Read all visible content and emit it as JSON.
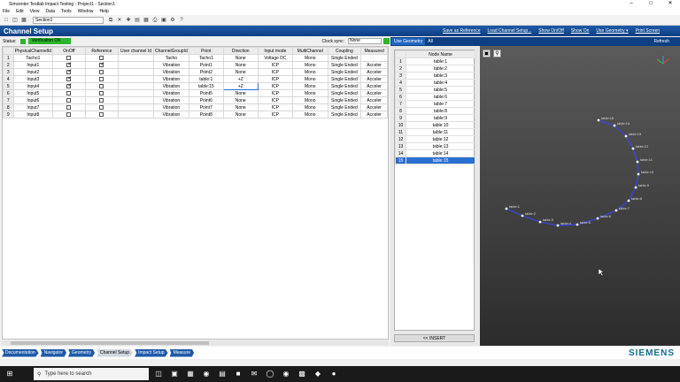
{
  "window": {
    "title": "Simcenter Testlab Impact Testing - Project1 - Section1"
  },
  "menu": [
    "File",
    "Edit",
    "View",
    "Data",
    "Tools",
    "Window",
    "Help"
  ],
  "toolbar": {
    "section_select": "Section1"
  },
  "header": {
    "title": "Channel Setup",
    "links": [
      "Save as Reference",
      "Load Channel Setup...",
      "Show On/Off",
      "Show On",
      "Use Geometry",
      "Print Screen"
    ],
    "use_geometry_caret": "▾"
  },
  "status": {
    "label": "Status:",
    "value": "Verification OK",
    "clock_label": "Clock sync:",
    "clock_value": "None"
  },
  "table": {
    "columns": [
      "",
      "PhysicalChannelId",
      "OnOff",
      "Reference",
      "User channel Id",
      "ChannelGroupId",
      "Point",
      "Direction",
      "Input mode",
      "MultiChannel",
      "Coupling",
      "Measured"
    ],
    "rows": [
      {
        "n": "1",
        "id": "Tacho1",
        "on": false,
        "ref": false,
        "uid": "",
        "group": "Tacho",
        "point": "Tacho1",
        "dir": "None",
        "mode": "Voltage DC",
        "multi": "Mono",
        "coup": "Single Ended",
        "meas": ""
      },
      {
        "n": "2",
        "id": "Input1",
        "on": true,
        "ref": true,
        "uid": "",
        "group": "Vibration",
        "point": "Point1",
        "dir": "None",
        "mode": "ICP",
        "multi": "Mono",
        "coup": "Single Ended",
        "meas": "Acceler"
      },
      {
        "n": "3",
        "id": "Input2",
        "on": true,
        "ref": false,
        "uid": "",
        "group": "Vibration",
        "point": "Point2",
        "dir": "None",
        "mode": "ICP",
        "multi": "Mono",
        "coup": "Single Ended",
        "meas": "Acceler"
      },
      {
        "n": "4",
        "id": "Input3",
        "on": true,
        "ref": false,
        "uid": "",
        "group": "Vibration",
        "point": "table:1",
        "dir": "+Z",
        "mode": "ICP",
        "multi": "Mono",
        "coup": "Single Ended",
        "meas": "Acceler"
      },
      {
        "n": "5",
        "id": "Input4",
        "on": true,
        "ref": false,
        "uid": "",
        "group": "Vibration",
        "point": "table:15",
        "dir": "+Z",
        "mode": "ICP",
        "multi": "Mono",
        "coup": "Single Ended",
        "meas": "Acceler"
      },
      {
        "n": "6",
        "id": "Input5",
        "on": false,
        "ref": false,
        "uid": "",
        "group": "Vibration",
        "point": "Point5",
        "dir": "None",
        "mode": "ICP",
        "multi": "Mono",
        "coup": "Single Ended",
        "meas": "Acceler"
      },
      {
        "n": "7",
        "id": "Input6",
        "on": false,
        "ref": false,
        "uid": "",
        "group": "Vibration",
        "point": "Point6",
        "dir": "None",
        "mode": "ICP",
        "multi": "Mono",
        "coup": "Single Ended",
        "meas": "Acceler"
      },
      {
        "n": "8",
        "id": "Input7",
        "on": false,
        "ref": false,
        "uid": "",
        "group": "Vibration",
        "point": "Point7",
        "dir": "None",
        "mode": "ICP",
        "multi": "Mono",
        "coup": "Single Ended",
        "meas": "Acceler"
      },
      {
        "n": "9",
        "id": "Input8",
        "on": false,
        "ref": false,
        "uid": "",
        "group": "Vibration",
        "point": "Point8",
        "dir": "None",
        "mode": "ICP",
        "multi": "Mono",
        "coup": "Single Ended",
        "meas": "Acceler"
      }
    ]
  },
  "geometry": {
    "tab": "Use Geometry",
    "filter": "All",
    "refresh": "Refresh",
    "node_header": "Node Name",
    "nodes": [
      "table:1",
      "table:2",
      "table:3",
      "table:4",
      "table:5",
      "table:6",
      "table:7",
      "table:8",
      "table:9",
      "table:10",
      "table:11",
      "table:12",
      "table:13",
      "table:14",
      "table:15"
    ],
    "selected_index": 14,
    "insert": "<< INSERT"
  },
  "nav": [
    "Documentation",
    "Navigator",
    "Geometry",
    "Channel Setup",
    "Impact Setup",
    "Measure"
  ],
  "nav_active": "Channel Setup",
  "brand": "SIEMENS",
  "taskbar": {
    "search_placeholder": "Type here to search"
  },
  "colors": {
    "header_blue": "#1e5aa8",
    "ok_green": "#2bb52b",
    "brand_teal": "#0f6d8e"
  }
}
